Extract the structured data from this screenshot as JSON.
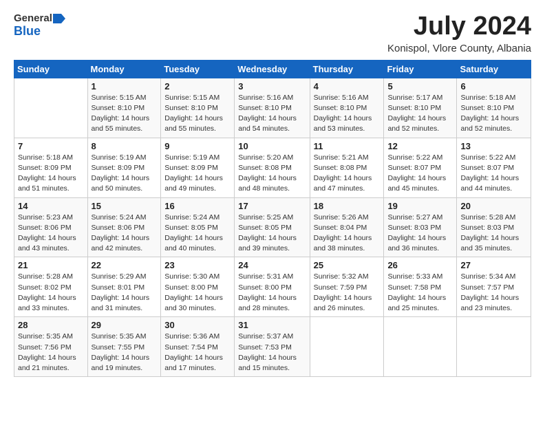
{
  "logo": {
    "general": "General",
    "blue": "Blue"
  },
  "title": "July 2024",
  "location": "Konispol, Vlore County, Albania",
  "headers": [
    "Sunday",
    "Monday",
    "Tuesday",
    "Wednesday",
    "Thursday",
    "Friday",
    "Saturday"
  ],
  "weeks": [
    [
      {
        "day": "",
        "info": ""
      },
      {
        "day": "1",
        "info": "Sunrise: 5:15 AM\nSunset: 8:10 PM\nDaylight: 14 hours\nand 55 minutes."
      },
      {
        "day": "2",
        "info": "Sunrise: 5:15 AM\nSunset: 8:10 PM\nDaylight: 14 hours\nand 55 minutes."
      },
      {
        "day": "3",
        "info": "Sunrise: 5:16 AM\nSunset: 8:10 PM\nDaylight: 14 hours\nand 54 minutes."
      },
      {
        "day": "4",
        "info": "Sunrise: 5:16 AM\nSunset: 8:10 PM\nDaylight: 14 hours\nand 53 minutes."
      },
      {
        "day": "5",
        "info": "Sunrise: 5:17 AM\nSunset: 8:10 PM\nDaylight: 14 hours\nand 52 minutes."
      },
      {
        "day": "6",
        "info": "Sunrise: 5:18 AM\nSunset: 8:10 PM\nDaylight: 14 hours\nand 52 minutes."
      }
    ],
    [
      {
        "day": "7",
        "info": "Sunrise: 5:18 AM\nSunset: 8:09 PM\nDaylight: 14 hours\nand 51 minutes."
      },
      {
        "day": "8",
        "info": "Sunrise: 5:19 AM\nSunset: 8:09 PM\nDaylight: 14 hours\nand 50 minutes."
      },
      {
        "day": "9",
        "info": "Sunrise: 5:19 AM\nSunset: 8:09 PM\nDaylight: 14 hours\nand 49 minutes."
      },
      {
        "day": "10",
        "info": "Sunrise: 5:20 AM\nSunset: 8:08 PM\nDaylight: 14 hours\nand 48 minutes."
      },
      {
        "day": "11",
        "info": "Sunrise: 5:21 AM\nSunset: 8:08 PM\nDaylight: 14 hours\nand 47 minutes."
      },
      {
        "day": "12",
        "info": "Sunrise: 5:22 AM\nSunset: 8:07 PM\nDaylight: 14 hours\nand 45 minutes."
      },
      {
        "day": "13",
        "info": "Sunrise: 5:22 AM\nSunset: 8:07 PM\nDaylight: 14 hours\nand 44 minutes."
      }
    ],
    [
      {
        "day": "14",
        "info": "Sunrise: 5:23 AM\nSunset: 8:06 PM\nDaylight: 14 hours\nand 43 minutes."
      },
      {
        "day": "15",
        "info": "Sunrise: 5:24 AM\nSunset: 8:06 PM\nDaylight: 14 hours\nand 42 minutes."
      },
      {
        "day": "16",
        "info": "Sunrise: 5:24 AM\nSunset: 8:05 PM\nDaylight: 14 hours\nand 40 minutes."
      },
      {
        "day": "17",
        "info": "Sunrise: 5:25 AM\nSunset: 8:05 PM\nDaylight: 14 hours\nand 39 minutes."
      },
      {
        "day": "18",
        "info": "Sunrise: 5:26 AM\nSunset: 8:04 PM\nDaylight: 14 hours\nand 38 minutes."
      },
      {
        "day": "19",
        "info": "Sunrise: 5:27 AM\nSunset: 8:03 PM\nDaylight: 14 hours\nand 36 minutes."
      },
      {
        "day": "20",
        "info": "Sunrise: 5:28 AM\nSunset: 8:03 PM\nDaylight: 14 hours\nand 35 minutes."
      }
    ],
    [
      {
        "day": "21",
        "info": "Sunrise: 5:28 AM\nSunset: 8:02 PM\nDaylight: 14 hours\nand 33 minutes."
      },
      {
        "day": "22",
        "info": "Sunrise: 5:29 AM\nSunset: 8:01 PM\nDaylight: 14 hours\nand 31 minutes."
      },
      {
        "day": "23",
        "info": "Sunrise: 5:30 AM\nSunset: 8:00 PM\nDaylight: 14 hours\nand 30 minutes."
      },
      {
        "day": "24",
        "info": "Sunrise: 5:31 AM\nSunset: 8:00 PM\nDaylight: 14 hours\nand 28 minutes."
      },
      {
        "day": "25",
        "info": "Sunrise: 5:32 AM\nSunset: 7:59 PM\nDaylight: 14 hours\nand 26 minutes."
      },
      {
        "day": "26",
        "info": "Sunrise: 5:33 AM\nSunset: 7:58 PM\nDaylight: 14 hours\nand 25 minutes."
      },
      {
        "day": "27",
        "info": "Sunrise: 5:34 AM\nSunset: 7:57 PM\nDaylight: 14 hours\nand 23 minutes."
      }
    ],
    [
      {
        "day": "28",
        "info": "Sunrise: 5:35 AM\nSunset: 7:56 PM\nDaylight: 14 hours\nand 21 minutes."
      },
      {
        "day": "29",
        "info": "Sunrise: 5:35 AM\nSunset: 7:55 PM\nDaylight: 14 hours\nand 19 minutes."
      },
      {
        "day": "30",
        "info": "Sunrise: 5:36 AM\nSunset: 7:54 PM\nDaylight: 14 hours\nand 17 minutes."
      },
      {
        "day": "31",
        "info": "Sunrise: 5:37 AM\nSunset: 7:53 PM\nDaylight: 14 hours\nand 15 minutes."
      },
      {
        "day": "",
        "info": ""
      },
      {
        "day": "",
        "info": ""
      },
      {
        "day": "",
        "info": ""
      }
    ]
  ]
}
